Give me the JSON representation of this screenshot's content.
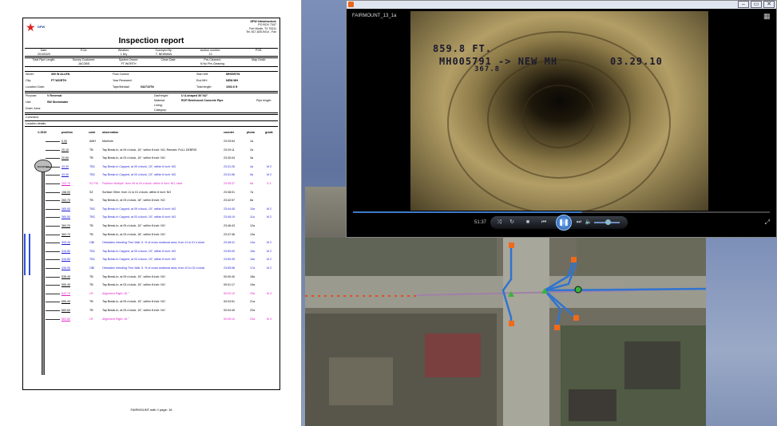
{
  "report": {
    "company_logo": "DFW",
    "company_name": "DFW Infrastructure",
    "address": [
      "PO BOX 7347",
      "Fort Worth, TX 76111",
      "Tel. 817-825-9414 , Fax"
    ],
    "title": "Inspection report",
    "row1": {
      "date_label": "Date:",
      "date": "20100329",
      "po_label": "P.O#:",
      "weather_label": "Weather:",
      "weather": "1 Dry",
      "surveyed_label": "Surveyed By:",
      "surveyed": "T. NEWMAN",
      "section_label": "section number:",
      "section": "13",
      "psr_label": "PSR:"
    },
    "row2": {
      "tpl_label": "Total Pipe Length:",
      "customer_label": "Survey Customer:",
      "customer": "JACOBS",
      "owner_label": "System Owner:",
      "owner": "FT WORTH",
      "clean_label": "Clean Date:",
      "precleaned_label": "Pre-Cleaned:",
      "precleaned": "N No Pre-Cleaning",
      "map_label": "Map Grid#:"
    },
    "block3": {
      "street_label": "Street:",
      "street": "300 W ALLEN",
      "city_label": "City:",
      "city": "FT WORTH",
      "location_label": "Location Code:",
      "flow_label": "Flow Control:",
      "year_label": "Year Renewed:",
      "tape_label": "Tape/Media#:",
      "tape": "032710TN",
      "start_label": "Start MH:",
      "start": "MH005791",
      "end_label": "End MH:",
      "end": "NEW MH",
      "length_label": "Total length:",
      "length": "1002.6 ft"
    },
    "block4": {
      "purpose_label": "Purpose:",
      "purpose": "V Reversal",
      "use_label": "Use:",
      "use": "SW Stormwater",
      "drain_label": "Drain. Area:",
      "dia_label": "Dia/Height:",
      "dia": "U U-shaped 36\"/42\"",
      "material_label": "Material:",
      "material": "RCP Reinforced Concrete Pipe",
      "lining_label": "Lining:",
      "category_label": "Category:",
      "pipelen_label": "Pipe length:"
    },
    "comment_label": "Comment:",
    "location_details_label": "Location details:",
    "columns": {
      "scale": "1:1519",
      "position": "position",
      "code": "code",
      "observation": "observation",
      "counter": "counter",
      "photo": "photo",
      "grade": "grade"
    },
    "manhole_label": "MH005791",
    "observations": [
      {
        "position": "0.00",
        "code": "AMH",
        "text": "Manhole",
        "counter": "23:25:54",
        "photo": "1a",
        "grade": "",
        "color": "#000000"
      },
      {
        "position": "20.10",
        "code": "TB",
        "text": "Tap Break-In, at 09 o'clock, 15\", within 8 inch: NO, Remark: FULL DEBRIS",
        "counter": "23:29:11",
        "photo": "2a",
        "grade": "",
        "color": "#000000"
      },
      {
        "position": "20.60",
        "code": "TB",
        "text": "Tap Break-In, at 03 o'clock, 15\", within 8 inch: NO",
        "counter": "23:30:04",
        "photo": "3a",
        "grade": "",
        "color": "#000000"
      },
      {
        "position": "43.30",
        "code": "TBC",
        "text": "Tap Break-In Capped, at 09 o'clock, 15\", within 8 inch: NO",
        "counter": "23:31:26",
        "photo": "4a",
        "grade": "M 2",
        "color": "#1a1ad8"
      },
      {
        "position": "43.30",
        "code": "TBC",
        "text": "Tap Break-In Capped, at 03 o'clock, 15\", within 8 inch: NO",
        "counter": "23:31:56",
        "photo": "5a",
        "grade": "M 2",
        "color": "#1a1ad8"
      },
      {
        "position": "102.70",
        "code": "S1 FM",
        "text": "Fracture Multiple, from 06 to 04 o'clock, within 8 inch: NO, start",
        "counter": "23:35:37",
        "photo": "6a",
        "grade": "S 4",
        "color": "#e020c8"
      },
      {
        "position": "158.00",
        "code": "SZ",
        "text": "Surface Other, from 11 to 01 o'clock, within 8 inch: NO",
        "counter": "23:38:01",
        "photo": "7a",
        "grade": "",
        "color": "#000000"
      },
      {
        "position": "260.70",
        "code": "TB",
        "text": "Tap Break-In, at 03 o'clock, 18\", within 8 inch: NO",
        "counter": "23:42:57",
        "photo": "8a",
        "grade": "",
        "color": "#000000"
      },
      {
        "position": "365.50",
        "code": "TBC",
        "text": "Tap Break-In Capped, at 09 o'clock, 15\", within 8 inch: NO",
        "counter": "23:44:45",
        "photo": "10a",
        "grade": "M 2",
        "color": "#1a1ad8"
      },
      {
        "position": "365.50",
        "code": "TBC",
        "text": "Tap Break-In Capped, at 03 o'clock, 15\", within 8 inch: NO",
        "counter": "23:45:19",
        "photo": "11a",
        "grade": "M 2",
        "color": "#1a1ad8"
      },
      {
        "position": "384.20",
        "code": "TB",
        "text": "Tap Break-In, at 09 o'clock, 15\", within 8 inch: NO",
        "counter": "23:46:43",
        "photo": "12a",
        "grade": "",
        "color": "#000000"
      },
      {
        "position": "384.70",
        "code": "TB",
        "text": "Tap Break-In, at 03 o'clock, 18\", within 8 inch: NO",
        "counter": "23:47:36",
        "photo": "13a",
        "grade": "",
        "color": "#000000"
      },
      {
        "position": "393.40",
        "code": "OBI",
        "text": "Obstacles Intruding Thru Wall, 5. % of cross sectional area, from 11 to 01 o'clock",
        "counter": "23:48:31",
        "photo": "14a",
        "grade": "M 2",
        "color": "#1a1ad8"
      },
      {
        "position": "416.50",
        "code": "TBC",
        "text": "Tap Break-In Capped, at 09 o'clock, 15\", within 8 inch: NO",
        "counter": "23:50:09",
        "photo": "15a",
        "grade": "M 2",
        "color": "#1a1ad8"
      },
      {
        "position": "416.50",
        "code": "TBC",
        "text": "Tap Break-In Capped, at 03 o'clock, 15\", within 8 inch: NO",
        "counter": "23:50:39",
        "photo": "16a",
        "grade": "M 2",
        "color": "#1a1ad8"
      },
      {
        "position": "435.90",
        "code": "OBI",
        "text": "Obstacles Intruding Thru Wall, 5. % of cross sectional area, from 10 to 02 o'clock",
        "counter": "23:55:58",
        "photo": "17a",
        "grade": "M 2",
        "color": "#1a1ad8"
      },
      {
        "position": "538.40",
        "code": "TB",
        "text": "Tap Break-In, at 09 o'clock, 15\", within 8 inch: NO",
        "counter": "00:00:40",
        "photo": "18a",
        "grade": "",
        "color": "#000000"
      },
      {
        "position": "559.40",
        "code": "TB",
        "text": "Tap Break-In, at 03 o'clock, 15\", within 8 inch: NO",
        "counter": "00:01:17",
        "photo": "19a",
        "grade": "",
        "color": "#000000"
      },
      {
        "position": "642.70",
        "code": "LR",
        "text": "Alignment Right, 45 °",
        "counter": "00:02:10",
        "photo": "20a",
        "grade": "M 4",
        "color": "#e020c8"
      },
      {
        "position": "655.40",
        "code": "TB",
        "text": "Tap Break-In, at 09 o'clock, 15\", within 8 inch: NO",
        "counter": "00:03:51",
        "photo": "21a",
        "grade": "",
        "color": "#000000"
      },
      {
        "position": "683.60",
        "code": "TB",
        "text": "Tap Break-In, at 03 o'clock, 15\", within 8 inch: NO",
        "counter": "00:04:45",
        "photo": "22a",
        "grade": "",
        "color": "#000000"
      },
      {
        "position": "563.60",
        "code": "LR",
        "text": "Alignment Right, 45 °",
        "counter": "00:05:10",
        "photo": "23a",
        "grade": "M 4",
        "color": "#e020c8"
      }
    ],
    "footer": "FAIRMOUNT.mdb  //  page: 16"
  },
  "player": {
    "title": "FAIRMOUNT_13_1a",
    "osd_distance": "859.8 FT.",
    "osd_route": "MH005791 -> NEW MH",
    "osd_date": "03.29.10",
    "osd_sub": "367.8",
    "time": "51:37",
    "progress": 0.55,
    "volume": 0.45
  },
  "colors": {
    "pipe_line": "#2f74d0",
    "marker_orange": "#f06a1a",
    "marker_green": "#3bb33b",
    "sewer_red": "#e05020",
    "accent": "#3e79c7"
  }
}
